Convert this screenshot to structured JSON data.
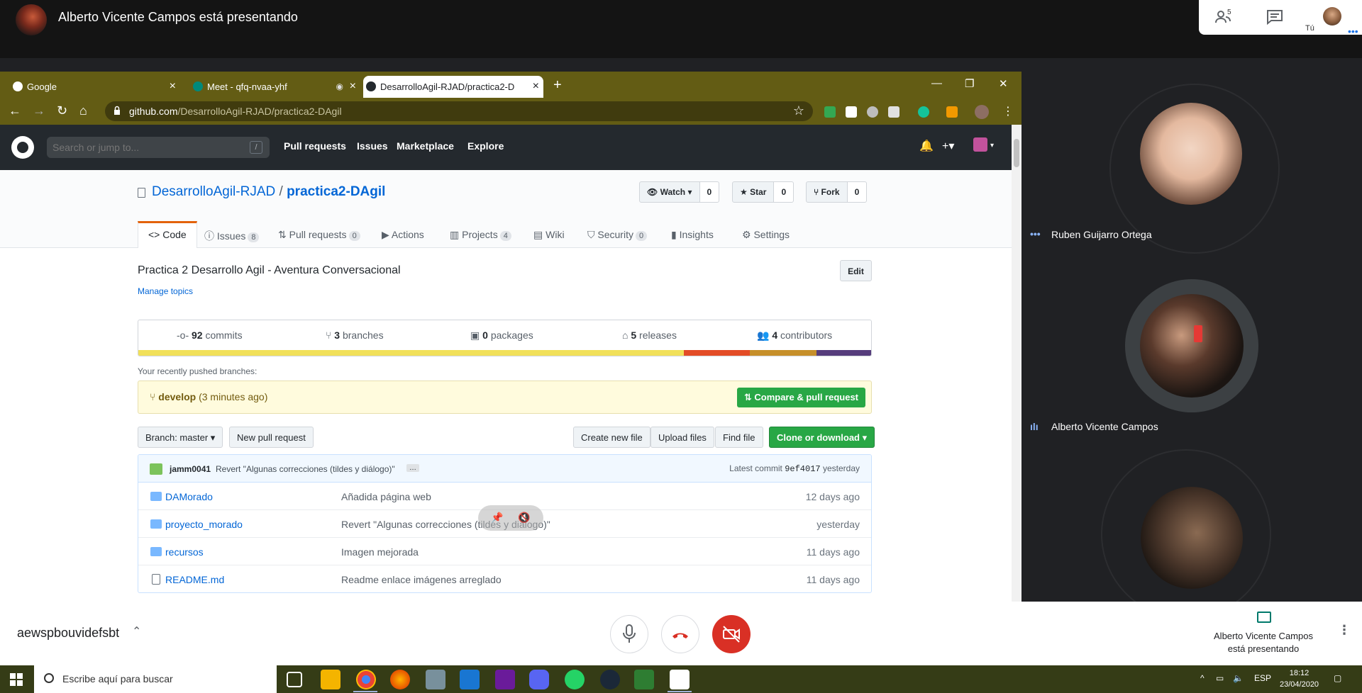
{
  "meet": {
    "presenter_title": "Alberto Vicente Campos está presentando",
    "people_count": "5",
    "self_label": "Tú",
    "meeting_code": "aewspbouvidefsbt",
    "present_line1": "Alberto Vicente Campos",
    "present_line2": "está presentando",
    "participants": [
      {
        "name": "Ruben Guijarro Ortega",
        "speaking_indicator": "•••"
      },
      {
        "name": "Alberto Vicente Campos",
        "speaking_indicator": "ılı"
      },
      {
        "name": "",
        "speaking_indicator": ""
      }
    ],
    "accent_color": "#1a73e8",
    "hangup_color": "#d93025"
  },
  "browser": {
    "tabs": [
      {
        "label": "Google"
      },
      {
        "label": "Meet - qfq-nvaa-yhf"
      },
      {
        "label": "DesarrolloAgil-RJAD/practica2-D"
      }
    ],
    "url_host": "github.com",
    "url_path": "/DesarrolloAgil-RJAD/practica2-DAgil",
    "frame_color": "#635c14"
  },
  "github": {
    "search_placeholder": "Search or jump to...",
    "search_shortcut": "/",
    "nav": [
      "Pull requests",
      "Issues",
      "Marketplace",
      "Explore"
    ],
    "repo_owner": "DesarrolloAgil-RJAD",
    "repo_sep": "/",
    "repo_name": "practica2-DAgil",
    "watch_label": "Watch",
    "watch_count": "0",
    "star_label": "Star",
    "star_count": "0",
    "fork_label": "Fork",
    "fork_count": "0",
    "tabs": [
      {
        "label": "Code",
        "count": ""
      },
      {
        "label": "Issues",
        "count": "8"
      },
      {
        "label": "Pull requests",
        "count": "0"
      },
      {
        "label": "Actions",
        "count": ""
      },
      {
        "label": "Projects",
        "count": "4"
      },
      {
        "label": "Wiki",
        "count": ""
      },
      {
        "label": "Security",
        "count": "0"
      },
      {
        "label": "Insights",
        "count": ""
      },
      {
        "label": "Settings",
        "count": ""
      }
    ],
    "description": "Practica 2 Desarrollo Agil - Aventura Conversacional",
    "manage_topics": "Manage topics",
    "edit_label": "Edit",
    "summary": {
      "commits_num": "92",
      "commits_label": "commits",
      "branches_num": "3",
      "branches_label": "branches",
      "packages_num": "0",
      "packages_label": "packages",
      "releases_num": "5",
      "releases_label": "releases",
      "contributors_num": "4",
      "contributors_label": "contributors"
    },
    "language_colors": [
      "#f1e05a",
      "#e34c26",
      "#c68f2a",
      "#563d7c"
    ],
    "pushed_label": "Your recently pushed branches:",
    "pushed_branch": "develop",
    "pushed_time": "(3 minutes ago)",
    "compare_label": "Compare & pull request",
    "branch_label": "Branch: master",
    "new_pr_label": "New pull request",
    "create_file_label": "Create new file",
    "upload_label": "Upload files",
    "find_file_label": "Find file",
    "clone_label": "Clone or download",
    "commit": {
      "author": "jamm0041",
      "message": "Revert \"Algunas correcciones (tildes y diálogo)\"",
      "ellipsis": "…",
      "latest_prefix": "Latest commit",
      "sha": "9ef4017",
      "when": "yesterday"
    },
    "files": [
      {
        "name": "DAMorado",
        "type": "dir",
        "message": "Añadida página web",
        "age": "12 days ago"
      },
      {
        "name": "proyecto_morado",
        "type": "dir",
        "message": "Revert \"Algunas correcciones (tildes y diálogo)\"",
        "age": "yesterday"
      },
      {
        "name": "recursos",
        "type": "dir",
        "message": "Imagen mejorada",
        "age": "11 days ago"
      },
      {
        "name": "README.md",
        "type": "file",
        "message": "Readme enlace imágenes arreglado",
        "age": "11 days ago"
      }
    ]
  },
  "taskbar": {
    "search_placeholder": "Escribe aquí para buscar",
    "lang": "ESP",
    "time": "18:12",
    "date": "23/04/2020"
  }
}
